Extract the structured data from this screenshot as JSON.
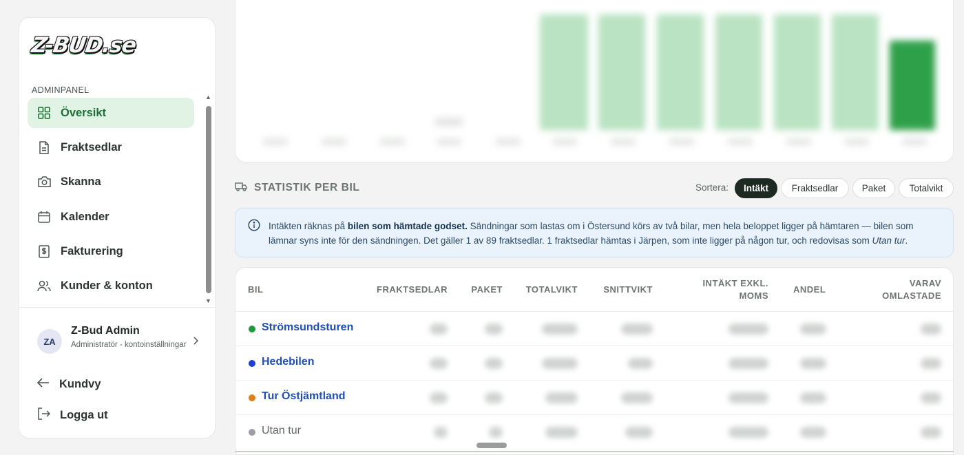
{
  "brand": {
    "logo_text": "Z-BUD.se",
    "panel_label": "ADMINPANEL"
  },
  "nav": {
    "items": [
      {
        "label": "Översikt",
        "icon": "grid-icon",
        "active": true
      },
      {
        "label": "Fraktsedlar",
        "icon": "document-icon",
        "active": false
      },
      {
        "label": "Skanna",
        "icon": "camera-icon",
        "active": false
      },
      {
        "label": "Kalender",
        "icon": "calendar-icon",
        "active": false
      },
      {
        "label": "Fakturering",
        "icon": "invoice-icon",
        "active": false
      },
      {
        "label": "Kunder & konton",
        "icon": "users-icon",
        "active": false
      }
    ]
  },
  "user": {
    "initials": "ZA",
    "name": "Z-Bud Admin",
    "subtitle": "Administratör - kontoinställningar"
  },
  "bottom": {
    "customer_view": "Kundvy",
    "logout": "Logga ut"
  },
  "section": {
    "title": "STATISTIK PER BIL",
    "sort_label": "Sortera:",
    "sort_options": [
      "Intäkt",
      "Fraktsedlar",
      "Paket",
      "Totalvikt"
    ],
    "sort_selected": "Intäkt"
  },
  "info": {
    "part1": "Intäkten räknas på ",
    "bold": "bilen som hämtade godset.",
    "part2": " Sändningar som lastas om i Östersund körs av två bilar, men hela beloppet ligger på hämtaren — bilen som lämnar syns inte för den sändningen. Det gäller 1 av 89 fraktsedlar. 1 fraktsedlar hämtas i Järpen, som inte ligger på någon tur, och redovisas som ",
    "italic": "Utan tur",
    "part3": "."
  },
  "table": {
    "headers": {
      "bil": "BIL",
      "fraktsedlar": "FRAKTSEDLAR",
      "paket": "PAKET",
      "totalvikt": "TOTALVIKT",
      "snittvikt": "SNITTVIKT",
      "intakt_1": "INTÄKT EXKL.",
      "intakt_2": "MOMS",
      "andel": "ANDEL",
      "varav_1": "VARAV",
      "varav_2": "OMLASTADE"
    },
    "rows": [
      {
        "name": "Strömsundsturen",
        "color": "#1f9a3e"
      },
      {
        "name": "Hedebilen",
        "color": "#1d3fd6"
      },
      {
        "name": "Tur Östjämtland",
        "color": "#e0801a"
      },
      {
        "name": "Utan tur",
        "color": "#9aa0a6"
      }
    ]
  },
  "colors": {
    "accent_green": "#1f9a3e",
    "active_nav_bg": "#e0f3e4",
    "info_bg": "#eaf3fb"
  }
}
